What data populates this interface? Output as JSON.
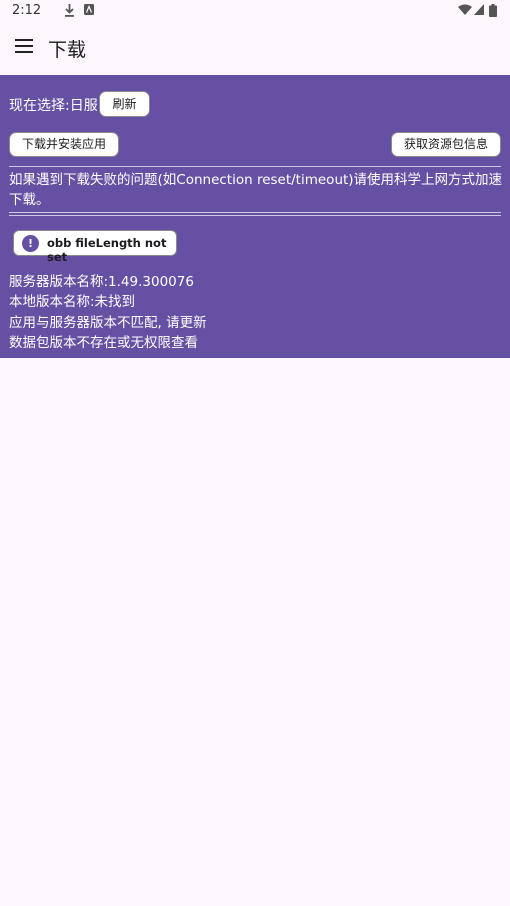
{
  "status_bar": {
    "time": "2:12",
    "left_icons": [
      "download-icon",
      "app-notification-icon"
    ],
    "right_icons": [
      "wifi-icon",
      "signal-icon",
      "battery-icon"
    ]
  },
  "app_bar": {
    "title": "下载",
    "menu_icon": "menu-icon"
  },
  "panel": {
    "selection_label": "现在选择:日服",
    "refresh_button": "刷新",
    "download_install_button": "下载并安装应用",
    "fetch_resource_button": "获取资源包信息",
    "notice": "如果遇到下载失败的问题(如Connection reset/timeout)请使用科学上网方式加速下载。",
    "error_chip": {
      "icon": "exclamation-icon",
      "label": "obb fileLength not set"
    },
    "info_lines": [
      "服务器版本名称:1.49.300076",
      "本地版本名称:未找到",
      "应用与服务器版本不匹配, 请更新",
      "数据包版本不存在或无权限查看"
    ]
  },
  "colors": {
    "panel_bg": "#6650a4",
    "page_bg": "#fdf7fd",
    "button_bg": "#ffffff"
  }
}
